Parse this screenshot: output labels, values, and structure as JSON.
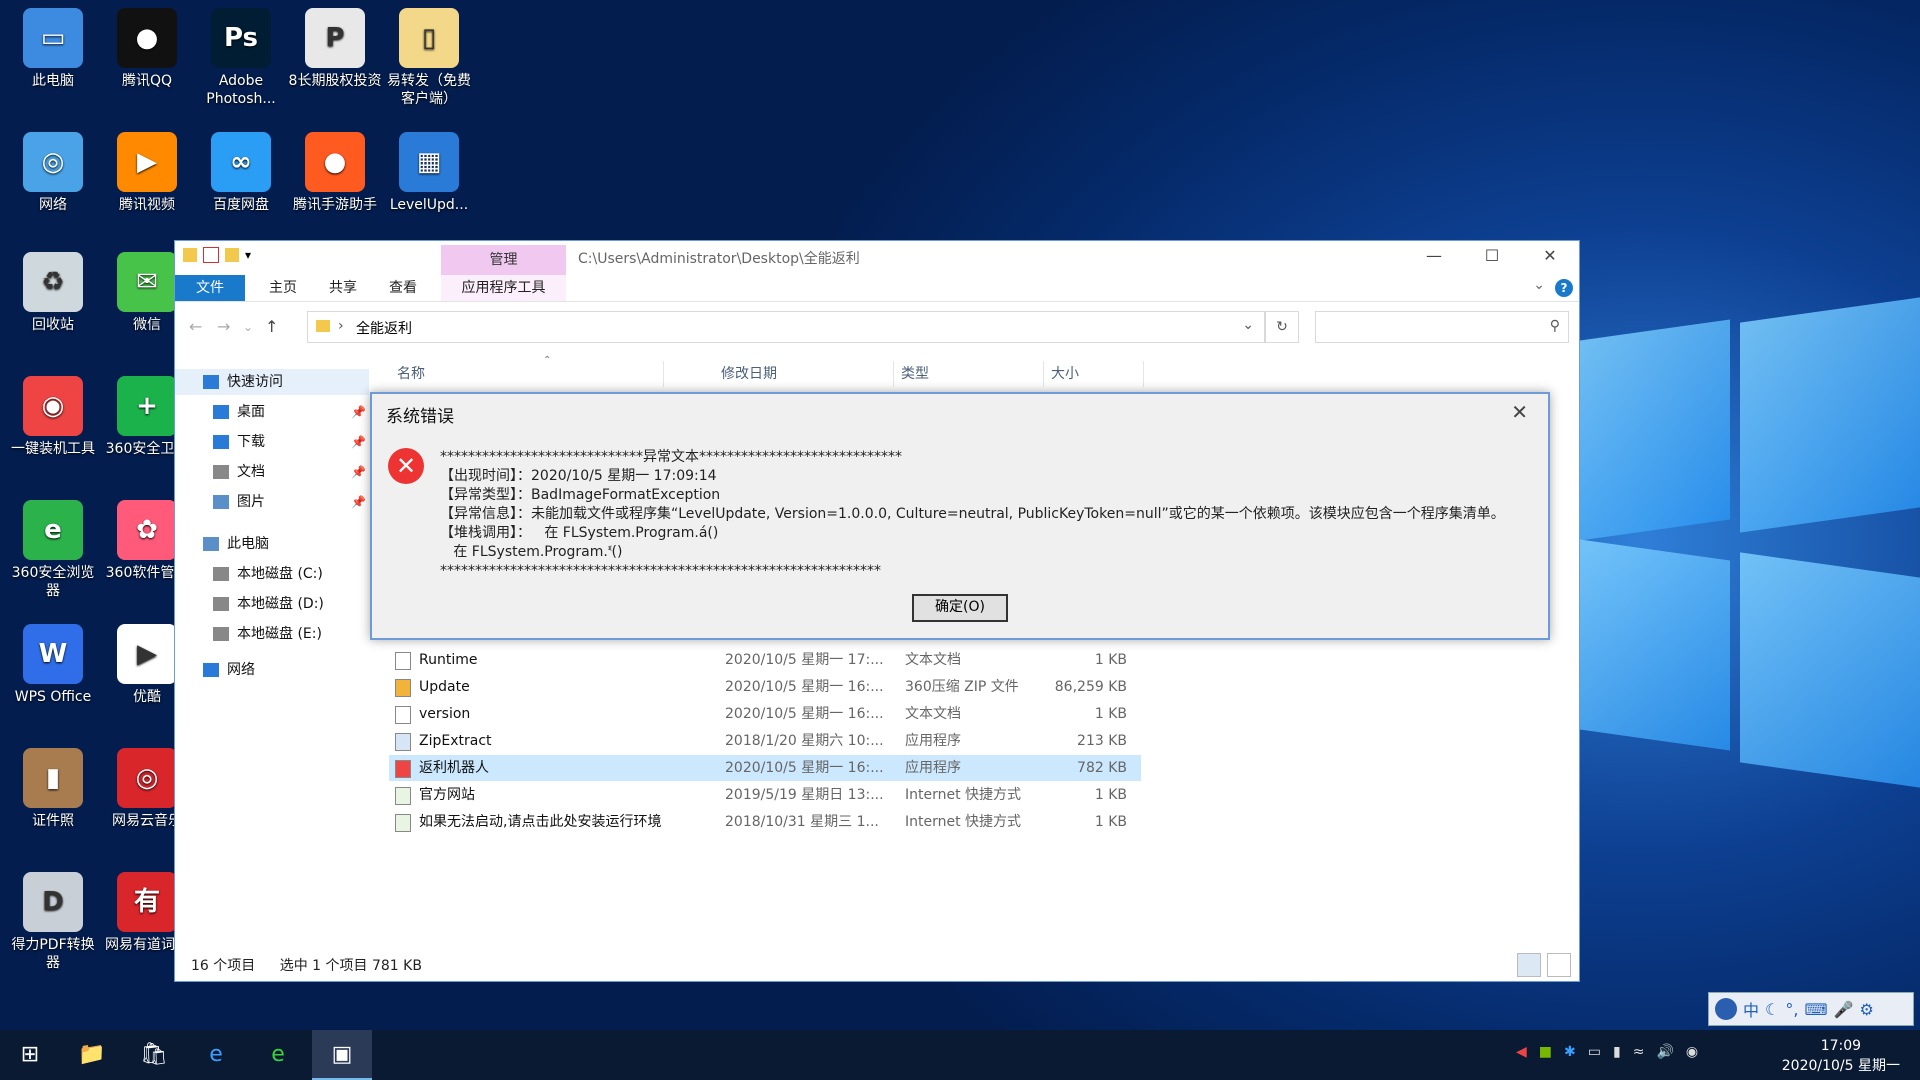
{
  "desktop_icons": [
    {
      "label": "此电脑",
      "icon": "computer-icon"
    },
    {
      "label": "腾讯QQ",
      "icon": "qq-icon"
    },
    {
      "label": "Adobe Photosh...",
      "icon": "photoshop-icon"
    },
    {
      "label": "8长期股权投资",
      "icon": "pptx-file-icon"
    },
    {
      "label": "易转发（免费客户端）",
      "icon": "folder-icon"
    },
    {
      "label": "网络",
      "icon": "network-icon"
    },
    {
      "label": "腾讯视频",
      "icon": "tencent-video-icon"
    },
    {
      "label": "百度网盘",
      "icon": "baidu-netdisk-icon"
    },
    {
      "label": "腾讯手游助手",
      "icon": "tencent-game-icon"
    },
    {
      "label": "LevelUpd...",
      "icon": "winrar-icon"
    },
    {
      "label": "回收站",
      "icon": "recycle-bin-icon"
    },
    {
      "label": "微信",
      "icon": "wechat-icon"
    },
    {
      "label": "一键装机工具",
      "icon": "install-tool-icon"
    },
    {
      "label": "360安全卫士",
      "icon": "360-security-icon"
    },
    {
      "label": "360安全浏览器",
      "icon": "360-browser-icon"
    },
    {
      "label": "360软件管家",
      "icon": "360-software-icon"
    },
    {
      "label": "WPS Office",
      "icon": "wps-icon"
    },
    {
      "label": "优酷",
      "icon": "youku-icon"
    },
    {
      "label": "证件照",
      "icon": "photo-icon"
    },
    {
      "label": "网易云音乐",
      "icon": "netease-music-icon"
    },
    {
      "label": "得力PDF转换器",
      "icon": "pdf-converter-icon"
    },
    {
      "label": "网易有道词典",
      "icon": "youdao-icon"
    }
  ],
  "explorer": {
    "manage_tab": "管理",
    "title_path": "C:\\Users\\Administrator\\Desktop\\全能返利",
    "ribbon_tabs": [
      "文件",
      "主页",
      "共享",
      "查看",
      "应用程序工具"
    ],
    "address": "全能返利",
    "help": "?",
    "nav": [
      {
        "label": "快速访问",
        "icon": "star-icon"
      },
      {
        "label": "桌面",
        "icon": "desktop-folder-icon"
      },
      {
        "label": "下载",
        "icon": "download-icon"
      },
      {
        "label": "文档",
        "icon": "documents-icon"
      },
      {
        "label": "图片",
        "icon": "pictures-icon"
      },
      {
        "label": "此电脑",
        "icon": "computer-icon"
      },
      {
        "label": "本地磁盘 (C:)",
        "icon": "drive-icon"
      },
      {
        "label": "本地磁盘 (D:)",
        "icon": "drive-icon"
      },
      {
        "label": "本地磁盘 (E:)",
        "icon": "drive-icon"
      },
      {
        "label": "网络",
        "icon": "network-icon"
      }
    ],
    "columns": [
      "名称",
      "修改日期",
      "类型",
      "大小"
    ],
    "files": [
      {
        "name": "Runtime",
        "date": "2020/10/5 星期一 17:...",
        "type": "文本文档",
        "size": "1 KB"
      },
      {
        "name": "Update",
        "date": "2020/10/5 星期一 16:...",
        "type": "360压缩 ZIP 文件",
        "size": "86,259 KB"
      },
      {
        "name": "version",
        "date": "2020/10/5 星期一 16:...",
        "type": "文本文档",
        "size": "1 KB"
      },
      {
        "name": "ZipExtract",
        "date": "2018/1/20 星期六 10:...",
        "type": "应用程序",
        "size": "213 KB"
      },
      {
        "name": "返利机器人",
        "date": "2020/10/5 星期一 16:...",
        "type": "应用程序",
        "size": "782 KB"
      },
      {
        "name": "官方网站",
        "date": "2019/5/19 星期日 13:...",
        "type": "Internet 快捷方式",
        "size": "1 KB"
      },
      {
        "name": "如果无法启动,请点击此处安装运行环境",
        "date": "2018/10/31 星期三 1...",
        "type": "Internet 快捷方式",
        "size": "1 KB"
      }
    ],
    "status_count": "16 个项目",
    "status_selected": "选中 1 个项目  781 KB"
  },
  "dialog": {
    "title": "系统错误",
    "message": "*****************************异常文本*****************************\n【出现时间】：2020/10/5 星期一 17:09:14\n【异常类型】：BadImageFormatException\n【异常信息】：未能加载文件或程序集“LevelUpdate, Version=1.0.0.0, Culture=neutral, PublicKeyToken=null”或它的某一个依赖项。该模块应包含一个程序集清单。\n【堆栈调用】：   在 FLSystem.Program.á()\n   在 FLSystem.Program.ᓫ()\n***************************************************************",
    "ok_label": "确定(O)"
  },
  "taskbar": {
    "time": "17:09",
    "date": "2020/10/5 星期一",
    "ime_label": "中"
  }
}
